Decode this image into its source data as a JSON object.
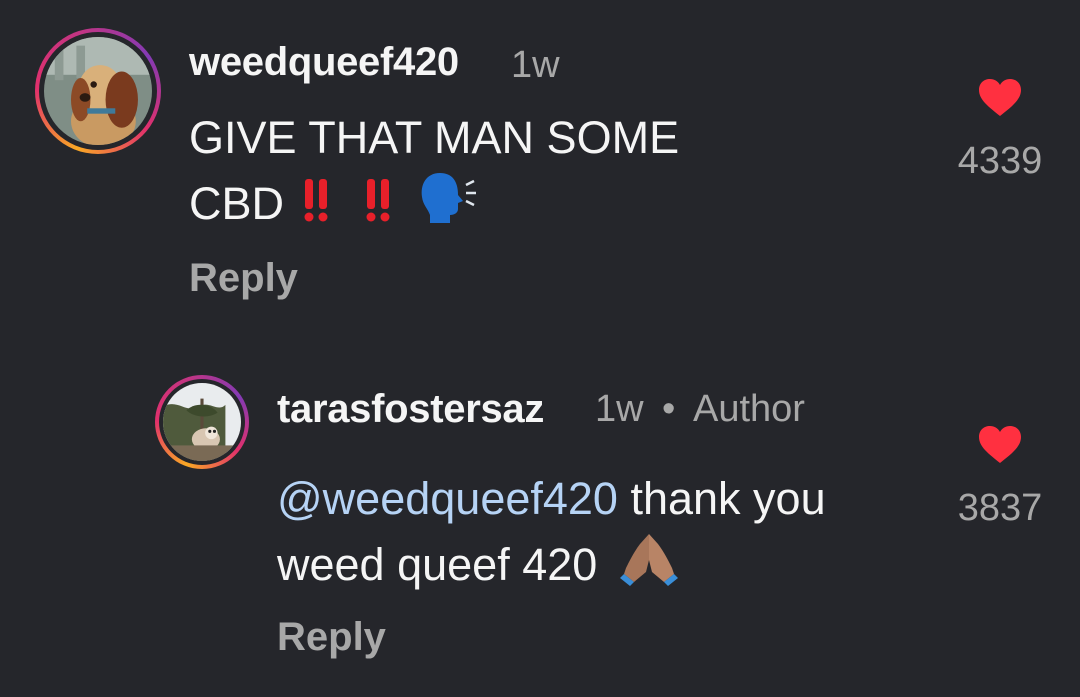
{
  "comments": [
    {
      "username": "weedqueef420",
      "time": "1w",
      "text_line1": "GIVE THAT MAN SOME",
      "text_line2": "CBD",
      "reply_label": "Reply",
      "likes": "4339",
      "avatar_icon": "lady-dog-avatar",
      "emojis": [
        "double-exclamation-icon",
        "double-exclamation-icon",
        "speaking-head-icon"
      ]
    },
    {
      "username": "tarasfostersaz",
      "time": "1w",
      "separator": "•",
      "author_badge": "Author",
      "mention": "@weedqueef420",
      "text_after_mention": " thank you",
      "text_line2": "weed queef 420",
      "reply_label": "Reply",
      "likes": "3837",
      "avatar_icon": "dog-outdoor-avatar",
      "emojis": [
        "folded-hands-icon"
      ]
    }
  ],
  "colors": {
    "background": "#25262b",
    "heart": "#ff3040",
    "secondary_text": "#a8a8a8",
    "mention": "#b6d3f5"
  }
}
